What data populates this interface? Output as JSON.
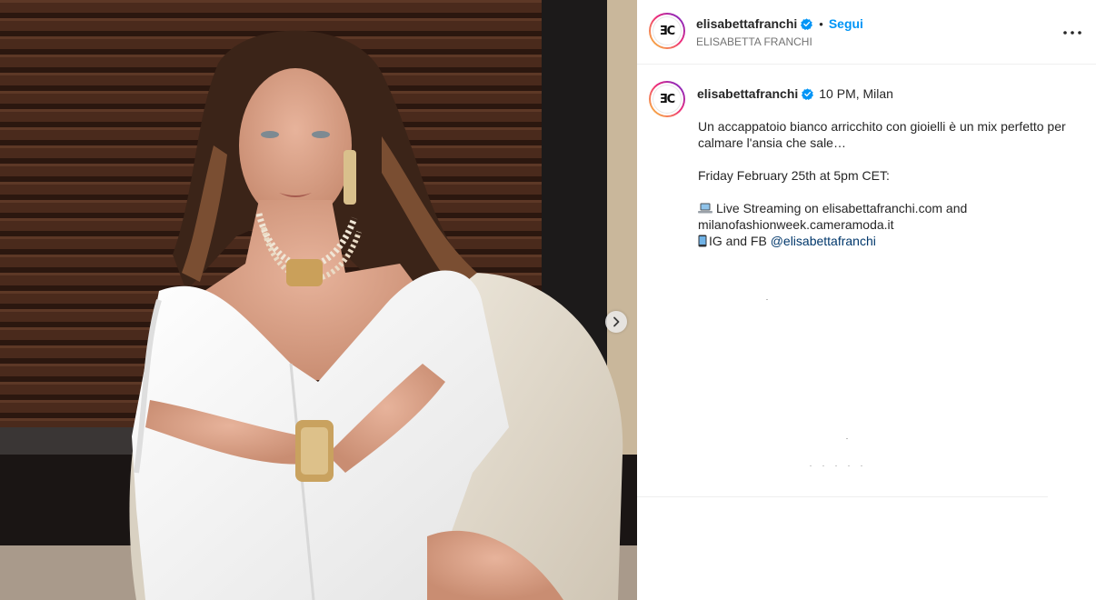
{
  "media": {
    "image_subject": "",
    "next_icon": "chevron-right-icon"
  },
  "header": {
    "username": "elisabettafranchi",
    "verified_icon": "verified-badge-icon",
    "separator": "•",
    "follow_label": "Segui",
    "subtitle": "ELISABETTA FRANCHI",
    "more_icon": "more-options-icon",
    "more_label": "•••",
    "avatar_logo": "ƎC"
  },
  "caption": {
    "username": "elisabettafranchi",
    "time_location": "10 PM, Milan",
    "paragraph1": "Un accappatoio bianco arricchito con gioielli è un mix perfetto per calmare l'ansia che sale…",
    "paragraph2": "Friday February 25th at 5pm CET:",
    "line3": "Live Streaming on elisabettafranchi.com and milanofashionweek.cameramoda.it",
    "line4_prefix": "IG and FB ",
    "mention": "@elisabettafranchi"
  },
  "colors": {
    "link_blue": "#0095f6",
    "mention": "#00376b",
    "verified": "#0095f6",
    "muted": "#737373"
  }
}
